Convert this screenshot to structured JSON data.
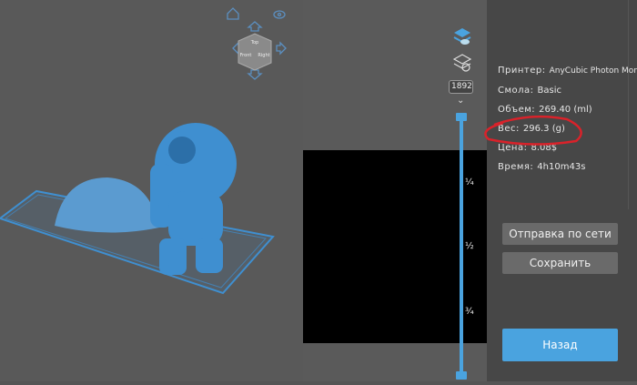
{
  "viewcube": {
    "faces": [
      "Top",
      "Front",
      "Right"
    ]
  },
  "layer_input": {
    "value": "1892"
  },
  "slider": {
    "marks": [
      "¼",
      "½",
      "¾"
    ]
  },
  "info": {
    "printer": {
      "label": "Принтер:",
      "value": "AnyCubic Photon Mono X"
    },
    "resin": {
      "label": "Смола:",
      "value": "Basic"
    },
    "volume": {
      "label": "Объем:",
      "value": "269.40  (ml)"
    },
    "weight": {
      "label": "Вес:",
      "value": "296.3  (g)"
    },
    "price": {
      "label": "Цена:",
      "value": "8.08$"
    },
    "time": {
      "label": "Время:",
      "value": "4h10m43s"
    }
  },
  "buttons": {
    "network": "Отправка по сети",
    "save": "Сохранить",
    "back": "Назад"
  },
  "colors": {
    "accent": "#4aa3df",
    "model": "#3f8fd0",
    "annotation": "#d9222a"
  }
}
